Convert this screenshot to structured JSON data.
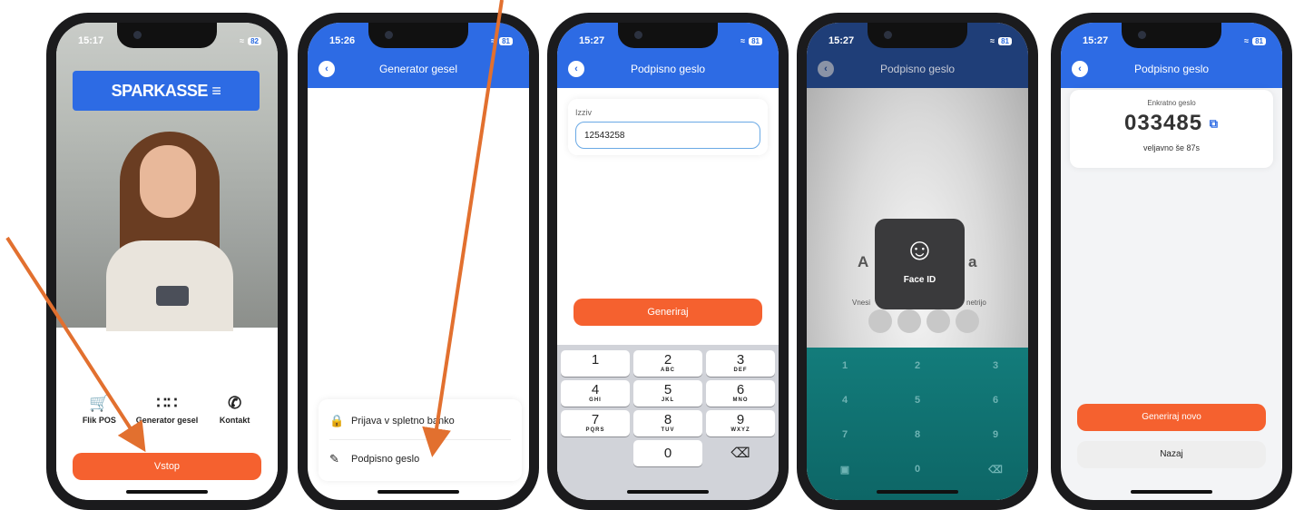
{
  "colors": {
    "brand_blue": "#2d6be4",
    "accent_orange": "#f5612f",
    "arrow": "#e2702f",
    "teal_keypad": "#137c7b"
  },
  "phone1": {
    "status_time": "15:17",
    "battery": "82",
    "logo_text": "SPARKASSE ≡",
    "menu_items": [
      {
        "icon": "cart-icon",
        "label": "Flik POS"
      },
      {
        "icon": "keypad-grid-icon",
        "label": "Generator gesel"
      },
      {
        "icon": "phone-icon",
        "label": "Kontakt"
      }
    ],
    "primary_button": "Vstop"
  },
  "phone2": {
    "status_time": "15:26",
    "battery": "81",
    "title": "Generator gesel",
    "options": [
      {
        "icon": "lock-icon",
        "label": "Prijava v spletno banko"
      },
      {
        "icon": "pencil-icon",
        "label": "Podpisno geslo"
      }
    ]
  },
  "phone3": {
    "status_time": "15:27",
    "battery": "81",
    "title": "Podpisno geslo",
    "field_label": "Izziv",
    "field_value": "12543258",
    "button": "Generiraj",
    "keypad": [
      {
        "n": "1",
        "l": ""
      },
      {
        "n": "2",
        "l": "ABC"
      },
      {
        "n": "3",
        "l": "DEF"
      },
      {
        "n": "4",
        "l": "GHI"
      },
      {
        "n": "5",
        "l": "JKL"
      },
      {
        "n": "6",
        "l": "MNO"
      },
      {
        "n": "7",
        "l": "PQRS"
      },
      {
        "n": "8",
        "l": "TUV"
      },
      {
        "n": "9",
        "l": "WXYZ"
      },
      {
        "n": "0",
        "l": ""
      }
    ],
    "delete_key": "⌫"
  },
  "phone4": {
    "status_time": "15:27",
    "battery": "81",
    "title": "Podpisno geslo",
    "partial_left": "A",
    "partial_right": "a",
    "sub_left": "Vnesi",
    "sub_right": "netrijo",
    "faceid_label": "Face ID",
    "keypad": [
      "1",
      "2",
      "3",
      "4",
      "5",
      "6",
      "7",
      "8",
      "9",
      "0"
    ]
  },
  "phone5": {
    "status_time": "15:27",
    "battery": "81",
    "title": "Podpisno geslo",
    "code_label": "Enkratno geslo",
    "code": "033485",
    "validity": "veljavno še 87s",
    "primary_button": "Generiraj novo",
    "secondary_button": "Nazaj"
  }
}
